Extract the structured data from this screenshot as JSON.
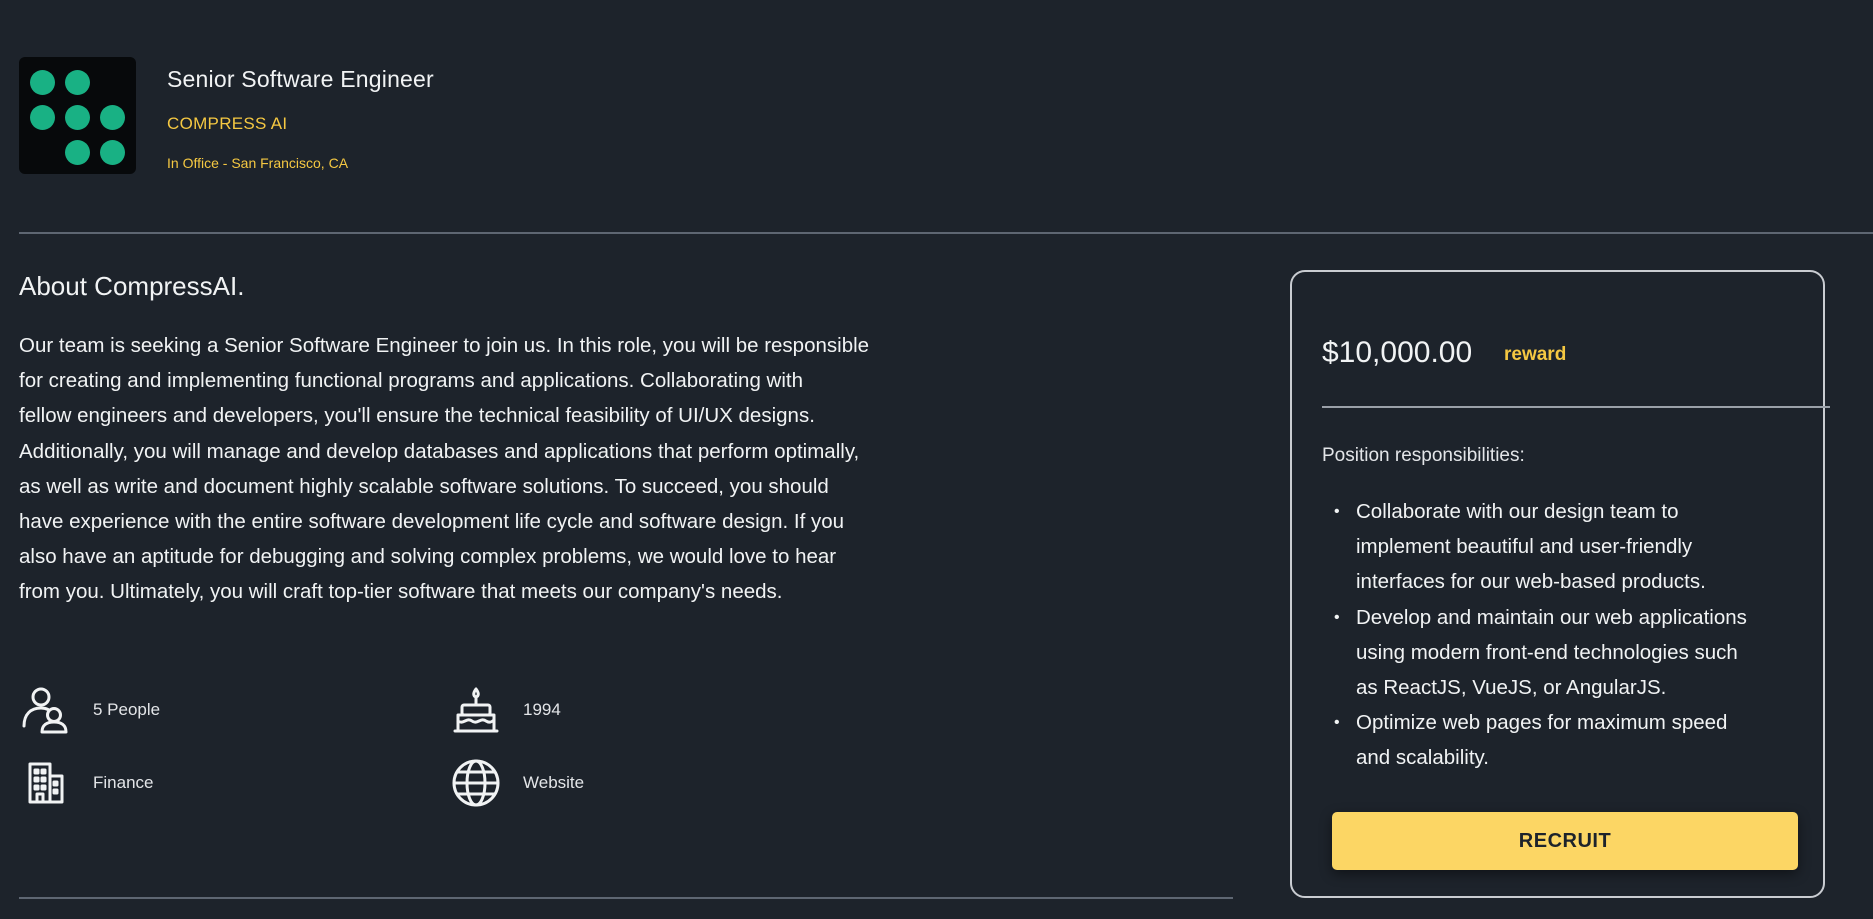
{
  "header": {
    "job_title": "Senior Software Engineer",
    "company": "COMPRESS AI",
    "location": "In Office - San Francisco, CA",
    "logo_dot_color": "#19b184"
  },
  "about": {
    "heading": "About CompressAI.",
    "lines": [
      "Our team is seeking a Senior Software Engineer to join us. In this role, you will be responsible",
      "for creating and implementing functional programs and applications. Collaborating with",
      "fellow engineers and developers, you'll ensure the technical feasibility of UI/UX designs.",
      "Additionally, you will manage and develop databases and applications that perform optimally,",
      "as well as write and document highly scalable software solutions. To succeed, you should",
      "have experience with the entire software development life cycle and software design. If you",
      "also have an aptitude for debugging and solving complex problems, we would love to hear",
      "from you. Ultimately, you will craft top-tier software that meets our company's needs."
    ]
  },
  "facts": {
    "people": {
      "label": "5 People",
      "icon": "people-icon"
    },
    "founded": {
      "label": "1994",
      "icon": "birthday-cake-icon"
    },
    "industry": {
      "label": "Finance",
      "icon": "building-icon"
    },
    "website": {
      "label": "Website",
      "icon": "globe-icon"
    }
  },
  "card": {
    "reward_amount": "$10,000.00",
    "reward_label": "reward",
    "responsibilities_heading": "Position responsibilities:",
    "responsibilities": [
      [
        "Collaborate with our design team to",
        "implement beautiful and user-friendly",
        "interfaces for our web-based products."
      ],
      [
        "Develop and maintain our web applications",
        "using modern front-end technologies such",
        "as ReactJS, VueJS, or AngularJS."
      ],
      [
        "Optimize web pages for maximum speed",
        "and scalability."
      ]
    ],
    "button_label": "RECRUIT",
    "accent_color": "#f5c842",
    "button_color": "#fcd664"
  }
}
